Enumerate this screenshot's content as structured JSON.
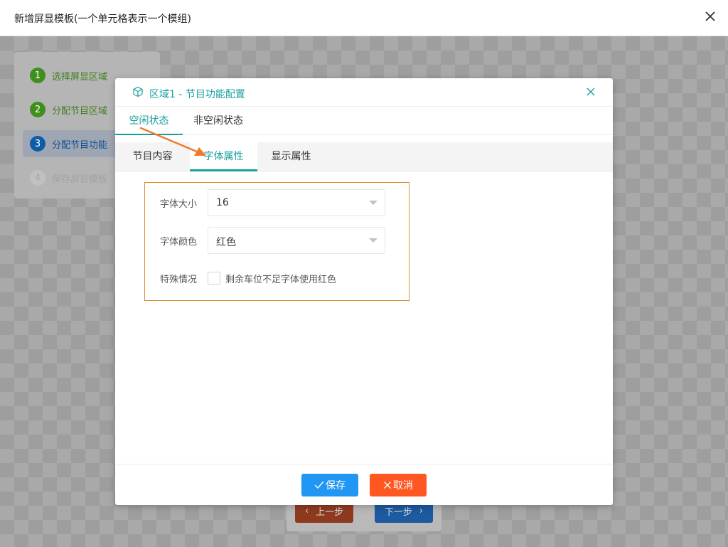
{
  "window": {
    "title": "新增屏显模板(一个单元格表示一个模组)"
  },
  "steps": [
    {
      "num": "1",
      "label": "选择屏显区域"
    },
    {
      "num": "2",
      "label": "分配节目区域"
    },
    {
      "num": "3",
      "label": "分配节目功能"
    },
    {
      "num": "4",
      "label": "保存屏显模板"
    }
  ],
  "nav": {
    "prev_label": "上一步",
    "next_label": "下一步"
  },
  "dialog": {
    "title": "区域1 - 节目功能配置",
    "state_tabs": [
      "空闲状态",
      "非空闲状态"
    ],
    "sub_tabs": [
      "节目内容",
      "字体属性",
      "显示属性"
    ],
    "form": {
      "font_size_label": "字体大小",
      "font_size_value": "16",
      "font_color_label": "字体颜色",
      "font_color_value": "红色",
      "special_label": "特殊情况",
      "special_option": "剩余车位不足字体使用红色"
    },
    "save_label": "保存",
    "cancel_label": "取消"
  },
  "colors": {
    "accent": "#1a9e9e",
    "save": "#2196f3",
    "cancel": "#ff5722",
    "highlight_border": "#e08a2e"
  }
}
